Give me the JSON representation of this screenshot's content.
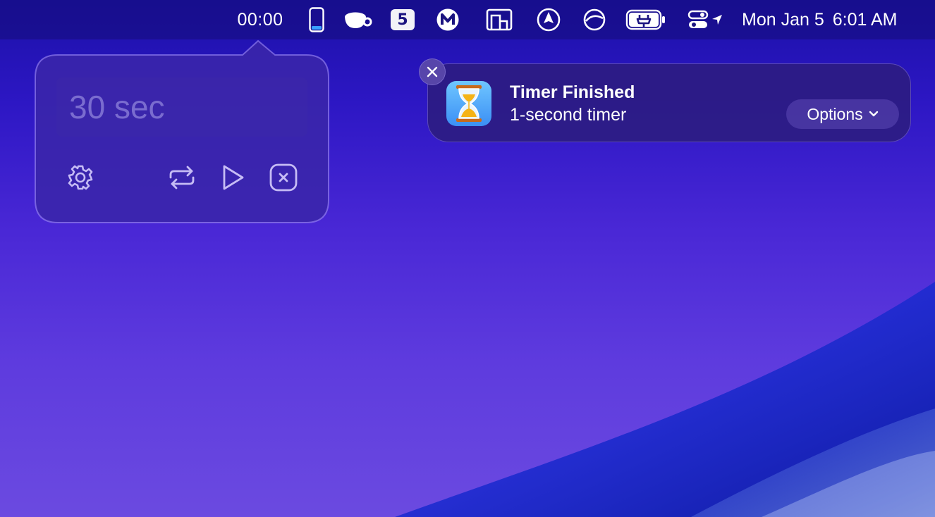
{
  "menubar": {
    "timer": "00:00",
    "date": "Mon Jan 5",
    "time": "6:01 AM",
    "badge": "5",
    "icons": [
      "phone-icon",
      "coffee-cup-icon",
      "number-5-badge-icon",
      "m-circle-icon",
      "building-icon",
      "navigation-icon",
      "rotation-icon",
      "battery-charging-icon",
      "control-center-icon",
      "location-arrow-icon"
    ]
  },
  "timer_popover": {
    "input_placeholder": "30 sec",
    "buttons": [
      "gear-icon",
      "repeat-icon",
      "play-icon",
      "stop-icon"
    ]
  },
  "notification": {
    "title": "Timer Finished",
    "body": "1-second timer",
    "options_label": "Options",
    "app_icon": "hourglass-icon"
  },
  "colors": {
    "menubar_bg": "#140c78",
    "notification_bg": "#2c1c82",
    "desktop_top": "#1b10a8",
    "desktop_bottom": "#6b4ae0"
  }
}
